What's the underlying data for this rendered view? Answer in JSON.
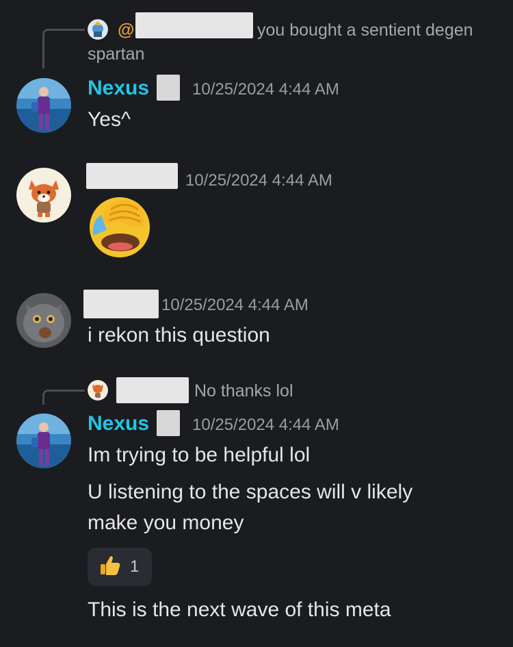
{
  "messages": [
    {
      "reply": {
        "mention": "@",
        "text": "you bought a sentient degen",
        "text2": "spartan"
      },
      "username": "Nexus",
      "timestamp": "10/25/2024 4:44 AM",
      "lines": [
        "Yes^"
      ]
    },
    {
      "timestamp": "10/25/2024 4:44 AM",
      "emoji": "face-with-hand-over-face-laughing"
    },
    {
      "timestamp": "10/25/2024 4:44 AM",
      "lines": [
        "i rekon this question"
      ]
    },
    {
      "reply": {
        "text": "No thanks lol"
      },
      "username": "Nexus",
      "timestamp": "10/25/2024 4:44 AM",
      "lines": [
        "Im trying to be helpful lol",
        "U listening to the spaces will v likely",
        "make you money"
      ],
      "reaction": {
        "icon": "thumbs-up-icon",
        "count": "1"
      },
      "after": "This is the next wave of this meta"
    }
  ],
  "colors": {
    "background": "#1b1c20",
    "username": "#1fc6e6",
    "mention": "#e7a13a",
    "timestamp": "#9a9da5"
  }
}
